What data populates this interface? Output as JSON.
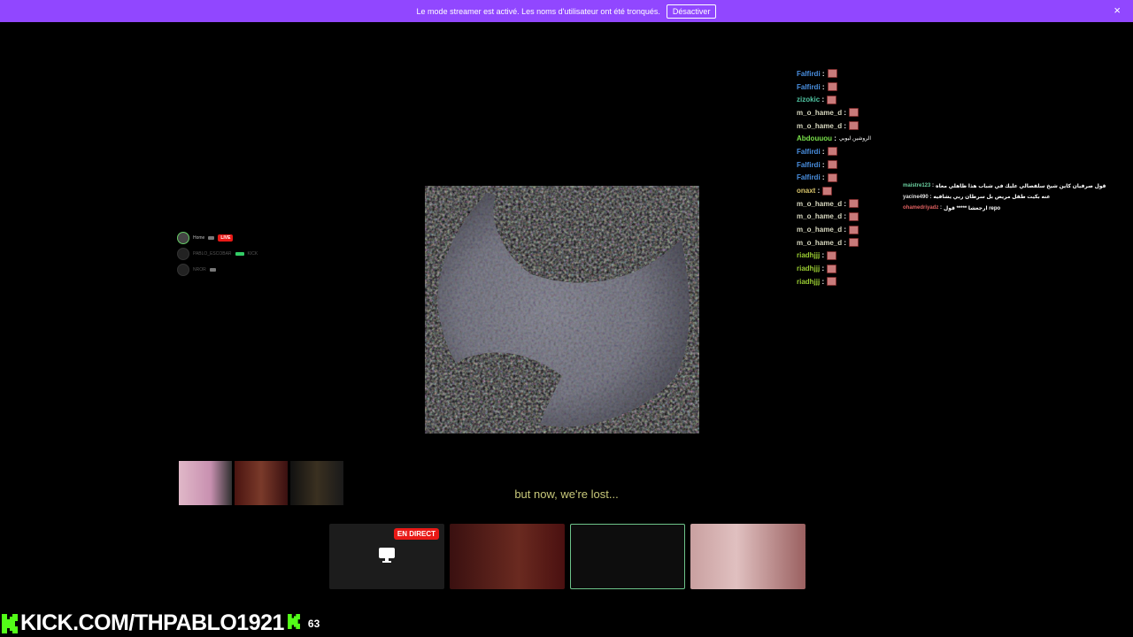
{
  "banner": {
    "message": "Le mode streamer est activé. Les noms d'utilisateur ont été tronqués.",
    "button_label": "Désactiver",
    "close_glyph": "×"
  },
  "mini_panel": {
    "rows": [
      {
        "name": "Home",
        "badge": "LIVE"
      },
      {
        "name": "PABLO_ESCOBAR",
        "badge": "KICK"
      },
      {
        "name": "NROR",
        "badge": ""
      }
    ]
  },
  "chat": {
    "lines": [
      {
        "user": "Falfirdi",
        "color": "#4a90e2",
        "emote": true,
        "text": ""
      },
      {
        "user": "Falfirdi",
        "color": "#4a90e2",
        "emote": true,
        "text": ""
      },
      {
        "user": "zizokic",
        "color": "#4fc3a1",
        "emote": true,
        "text": ""
      },
      {
        "user": "m_o_hame_d",
        "color": "#d8d8c0",
        "emote": true,
        "text": ""
      },
      {
        "user": "m_o_hame_d",
        "color": "#d8d8c0",
        "emote": true,
        "text": ""
      },
      {
        "user": "Abdouuou",
        "color": "#78e04a",
        "emote": false,
        "text": "الروشين ليوبي"
      },
      {
        "user": "Falfirdi",
        "color": "#4a90e2",
        "emote": true,
        "text": ""
      },
      {
        "user": "Falfirdi",
        "color": "#4a90e2",
        "emote": true,
        "text": ""
      },
      {
        "user": "Falfirdi",
        "color": "#4a90e2",
        "emote": true,
        "text": ""
      },
      {
        "user": "onaxt",
        "color": "#d8c46a",
        "emote": true,
        "text": ""
      },
      {
        "user": "m_o_hame_d",
        "color": "#d8d8c0",
        "emote": true,
        "text": ""
      },
      {
        "user": "m_o_hame_d",
        "color": "#d8d8c0",
        "emote": true,
        "text": ""
      },
      {
        "user": "m_o_hame_d",
        "color": "#d8d8c0",
        "emote": true,
        "text": ""
      },
      {
        "user": "m_o_hame_d",
        "color": "#d8d8c0",
        "emote": true,
        "text": ""
      },
      {
        "user": "riadhjjj",
        "color": "#9acd32",
        "emote": true,
        "text": ""
      },
      {
        "user": "riadhjjj",
        "color": "#9acd32",
        "emote": true,
        "text": ""
      },
      {
        "user": "riadhjjj",
        "color": "#9acd32",
        "emote": true,
        "text": ""
      }
    ]
  },
  "chat2": {
    "lines": [
      {
        "user": "maistre123",
        "color": "#6ad0a0",
        "text": "قول صرفيان كاين شيخ سلفصالي عليك في شباب هذا ظاهلي معاه"
      },
      {
        "user": "yacine490",
        "color": "#e0e0e0",
        "text": "عنه بكيت طفل مريض بل سرطان ربي يشافيه"
      },
      {
        "user": "ohamedriyadz",
        "color": "#e06060",
        "text": "ارجعشا ***** قول repo"
      }
    ]
  },
  "subtitle": "but now, we're lost...",
  "cams": {
    "live_badge": "EN DIRECT"
  },
  "footer": {
    "url": "KICK.COM/THPABLO1921",
    "count": "63"
  },
  "colors": {
    "banner": "#9147ff",
    "kick_green": "#53fc18",
    "live_red": "#e91916"
  }
}
